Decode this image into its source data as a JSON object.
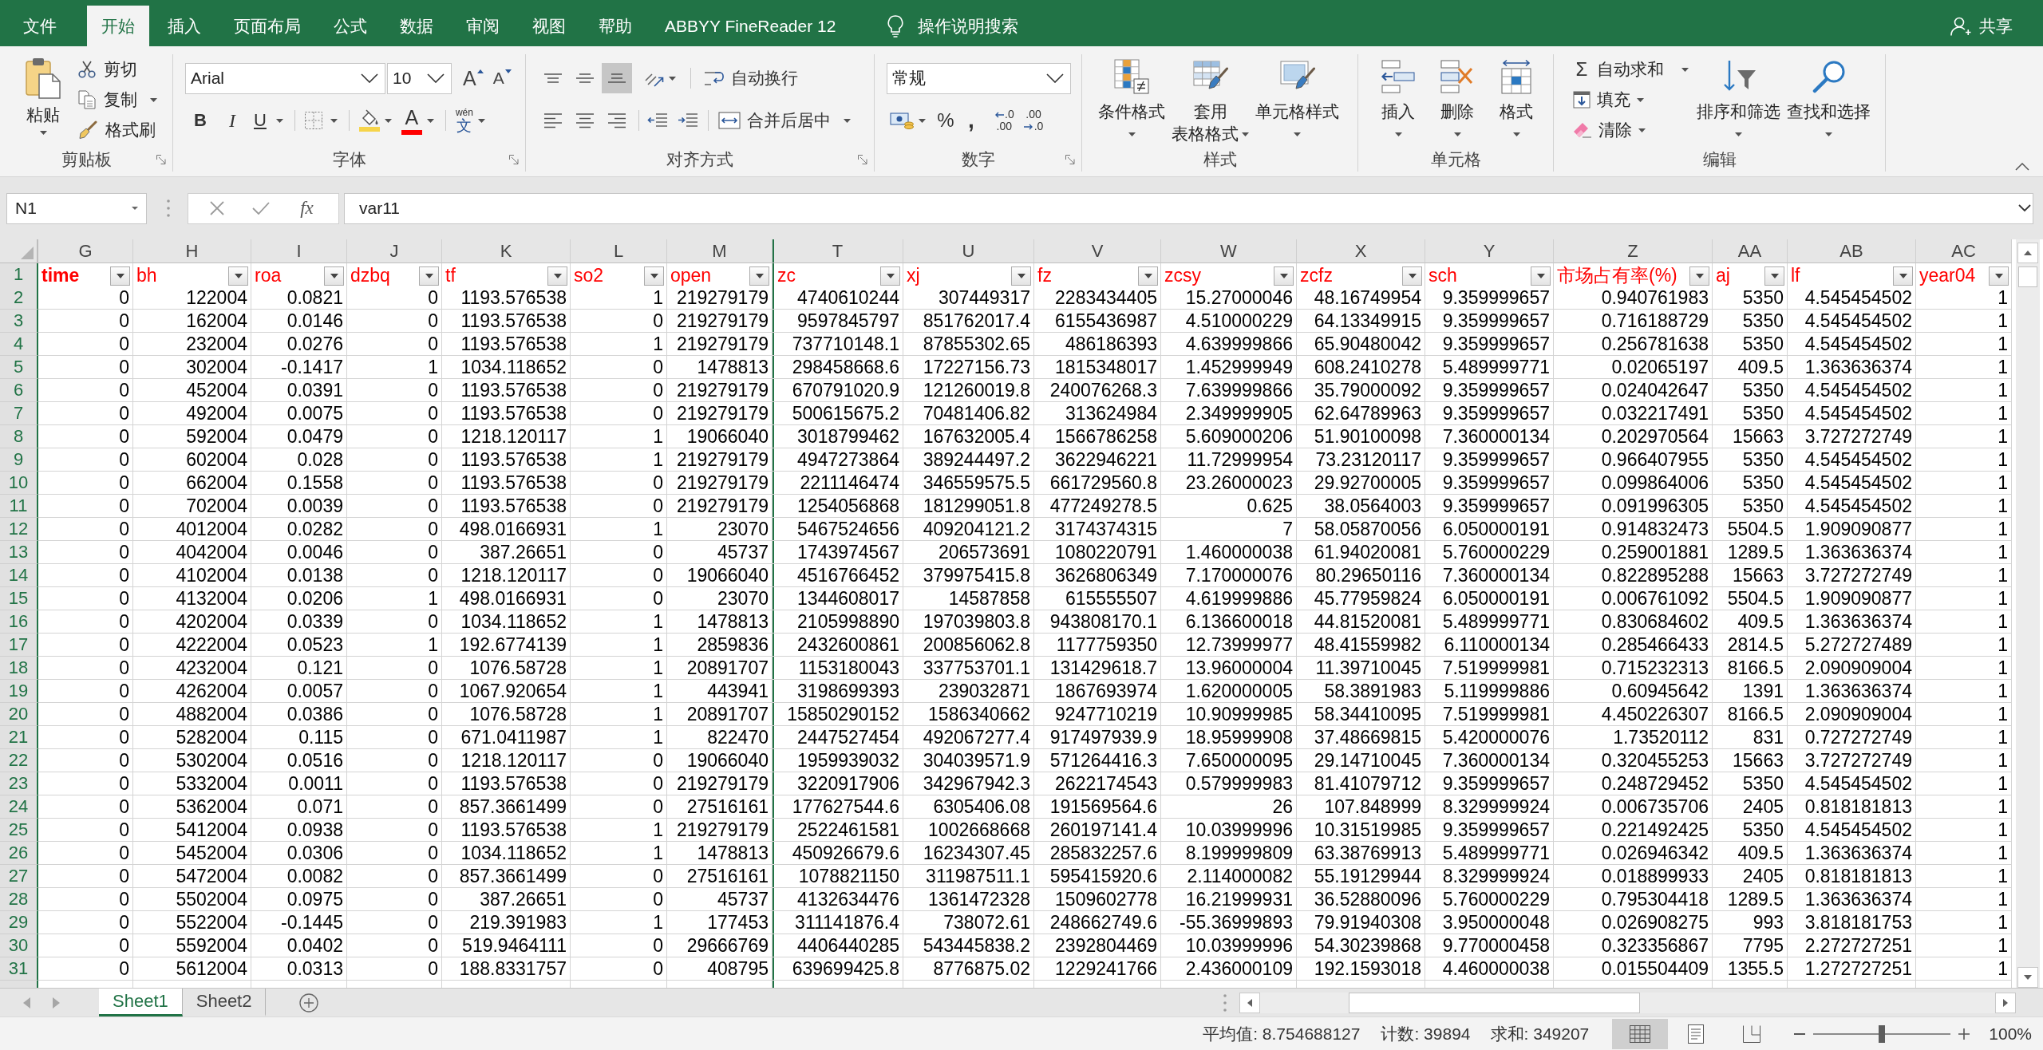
{
  "menu_tabs": [
    {
      "label": "文件",
      "selected": false
    },
    {
      "label": "开始",
      "selected": true
    },
    {
      "label": "插入",
      "selected": false
    },
    {
      "label": "页面布局",
      "selected": false
    },
    {
      "label": "公式",
      "selected": false
    },
    {
      "label": "数据",
      "selected": false
    },
    {
      "label": "审阅",
      "selected": false
    },
    {
      "label": "视图",
      "selected": false
    },
    {
      "label": "帮助",
      "selected": false
    },
    {
      "label": "ABBYY FineReader 12",
      "selected": false
    }
  ],
  "tell_me": "操作说明搜索",
  "share": "共享",
  "ribbon": {
    "clipboard": {
      "label": "剪贴板",
      "paste": "粘贴",
      "cut": "剪切",
      "copy": "复制",
      "format_painter": "格式刷"
    },
    "font": {
      "label": "字体",
      "font_name": "Arial",
      "font_size": "10",
      "grow": "A",
      "shrink": "A",
      "bold": "B",
      "italic": "I",
      "underline": "U",
      "font_color": "A",
      "phonetic": "wén",
      "phonetic_char": "文"
    },
    "alignment": {
      "label": "对齐方式",
      "vertical": [
        {
          "kind": "top",
          "selected": false
        },
        {
          "kind": "middle",
          "selected": false
        },
        {
          "kind": "bottom",
          "selected": true
        }
      ],
      "horizontal": [
        {
          "kind": "left",
          "selected": false
        },
        {
          "kind": "center",
          "selected": false
        },
        {
          "kind": "right",
          "selected": false
        }
      ],
      "wrap_text": "自动换行",
      "merge_center": "合并后居中"
    },
    "number": {
      "label": "数字",
      "format": "常规",
      "percent": "%",
      "comma": ",",
      "increase_decimal": [
        ".0",
        ".00"
      ],
      "decrease_decimal": [
        ".00",
        ".0"
      ]
    },
    "styles": {
      "label": "样式",
      "buttons": [
        {
          "kind": "conditional_formatting",
          "label": "条件格式"
        },
        {
          "kind": "format_as_table",
          "label": "套用",
          "label_2": "表格格式"
        },
        {
          "kind": "cell_styles",
          "label": "单元格样式"
        }
      ]
    },
    "cells": {
      "label": "单元格",
      "buttons": [
        {
          "kind": "insert",
          "label": "插入"
        },
        {
          "kind": "delete",
          "label": "删除"
        },
        {
          "kind": "format",
          "label": "格式"
        }
      ]
    },
    "editing": {
      "label": "编辑",
      "autosum_symbol": "Σ",
      "autosum": "自动求和",
      "fill": "填充",
      "clear": "清除",
      "buttons": [
        {
          "kind": "sort_filter",
          "label": "排序和筛选"
        },
        {
          "kind": "find_select",
          "label": "查找和选择"
        }
      ]
    }
  },
  "formula_bar": {
    "name_box": "N1",
    "function_symbol": "fx",
    "formula": "var11"
  },
  "sheet": {
    "columns": [
      {
        "letter": "G",
        "name": "time",
        "bold": true,
        "selected_edge": false
      },
      {
        "letter": "H",
        "name": "bh",
        "bold": false,
        "selected_edge": false
      },
      {
        "letter": "I",
        "name": "roa",
        "bold": false,
        "selected_edge": false
      },
      {
        "letter": "J",
        "name": "dzbq",
        "bold": false,
        "selected_edge": false
      },
      {
        "letter": "K",
        "name": "tf",
        "bold": false,
        "selected_edge": false
      },
      {
        "letter": "L",
        "name": "so2",
        "bold": false,
        "selected_edge": false
      },
      {
        "letter": "M",
        "name": "open",
        "bold": false,
        "selected_edge": false
      },
      {
        "letter": "T",
        "name": "zc",
        "bold": false,
        "selected_edge": true
      },
      {
        "letter": "U",
        "name": "xj",
        "bold": false,
        "selected_edge": false
      },
      {
        "letter": "V",
        "name": "fz",
        "bold": false,
        "selected_edge": false
      },
      {
        "letter": "W",
        "name": "zcsy",
        "bold": false,
        "selected_edge": false
      },
      {
        "letter": "X",
        "name": "zcfz",
        "bold": false,
        "selected_edge": false
      },
      {
        "letter": "Y",
        "name": "sch",
        "bold": false,
        "selected_edge": false
      },
      {
        "letter": "Z",
        "name": "市场占有率(%)",
        "bold": false,
        "selected_edge": false
      },
      {
        "letter": "AA",
        "name": "aj",
        "bold": false,
        "selected_edge": false
      },
      {
        "letter": "AB",
        "name": "lf",
        "bold": false,
        "selected_edge": false
      },
      {
        "letter": "AC",
        "name": "year04",
        "bold": false,
        "selected_edge": false
      }
    ],
    "header_row_number": "1",
    "rows": [
      {
        "number": "2",
        "cells": [
          "0",
          "122004",
          "0.0821",
          "0",
          "1193.576538",
          "1",
          "219279179",
          "4740610244",
          "307449317",
          "2283434405",
          "15.27000046",
          "48.16749954",
          "9.359999657",
          "0.940761983",
          "5350",
          "4.545454502",
          "1"
        ]
      },
      {
        "number": "3",
        "cells": [
          "0",
          "162004",
          "0.0146",
          "0",
          "1193.576538",
          "0",
          "219279179",
          "9597845797",
          "851762017.4",
          "6155436987",
          "4.510000229",
          "64.13349915",
          "9.359999657",
          "0.716188729",
          "5350",
          "4.545454502",
          "1"
        ]
      },
      {
        "number": "4",
        "cells": [
          "0",
          "232004",
          "0.0276",
          "0",
          "1193.576538",
          "1",
          "219279179",
          "737710148.1",
          "87855302.65",
          "486186393",
          "4.639999866",
          "65.90480042",
          "9.359999657",
          "0.256781638",
          "5350",
          "4.545454502",
          "1"
        ]
      },
      {
        "number": "5",
        "cells": [
          "0",
          "302004",
          "-0.1417",
          "1",
          "1034.118652",
          "0",
          "1478813",
          "298458668.6",
          "17227156.73",
          "1815348017",
          "1.452999949",
          "608.2410278",
          "5.489999771",
          "0.02065197",
          "409.5",
          "1.363636374",
          "1"
        ]
      },
      {
        "number": "6",
        "cells": [
          "0",
          "452004",
          "0.0391",
          "0",
          "1193.576538",
          "0",
          "219279179",
          "670791020.9",
          "121260019.8",
          "240076268.3",
          "7.639999866",
          "35.79000092",
          "9.359999657",
          "0.024042647",
          "5350",
          "4.545454502",
          "1"
        ]
      },
      {
        "number": "7",
        "cells": [
          "0",
          "492004",
          "0.0075",
          "0",
          "1193.576538",
          "0",
          "219279179",
          "500615675.2",
          "70481406.82",
          "313624984",
          "2.349999905",
          "62.64789963",
          "9.359999657",
          "0.032217491",
          "5350",
          "4.545454502",
          "1"
        ]
      },
      {
        "number": "8",
        "cells": [
          "0",
          "592004",
          "0.0479",
          "0",
          "1218.120117",
          "1",
          "19066040",
          "3018799462",
          "167632005.4",
          "1566786258",
          "5.609000206",
          "51.90100098",
          "7.360000134",
          "0.202970564",
          "15663",
          "3.727272749",
          "1"
        ]
      },
      {
        "number": "9",
        "cells": [
          "0",
          "602004",
          "0.028",
          "0",
          "1193.576538",
          "1",
          "219279179",
          "4947273864",
          "389244497.2",
          "3622946221",
          "11.72999954",
          "73.23120117",
          "9.359999657",
          "0.966407955",
          "5350",
          "4.545454502",
          "1"
        ]
      },
      {
        "number": "10",
        "cells": [
          "0",
          "662004",
          "0.1558",
          "0",
          "1193.576538",
          "0",
          "219279179",
          "2211146474",
          "346559575.5",
          "661729560.8",
          "23.26000023",
          "29.92700005",
          "9.359999657",
          "0.099864006",
          "5350",
          "4.545454502",
          "1"
        ]
      },
      {
        "number": "11",
        "cells": [
          "0",
          "702004",
          "0.0039",
          "0",
          "1193.576538",
          "0",
          "219279179",
          "1254056868",
          "181299051.8",
          "477249278.5",
          "0.625",
          "38.0564003",
          "9.359999657",
          "0.091996305",
          "5350",
          "4.545454502",
          "1"
        ]
      },
      {
        "number": "12",
        "cells": [
          "0",
          "4012004",
          "0.0282",
          "0",
          "498.0166931",
          "1",
          "23070",
          "5467524656",
          "409204121.2",
          "3174374315",
          "7",
          "58.05870056",
          "6.050000191",
          "0.914832473",
          "5504.5",
          "1.909090877",
          "1"
        ]
      },
      {
        "number": "13",
        "cells": [
          "0",
          "4042004",
          "0.0046",
          "0",
          "387.26651",
          "0",
          "45737",
          "1743974567",
          "206573691",
          "1080220791",
          "1.460000038",
          "61.94020081",
          "5.760000229",
          "0.259001881",
          "1289.5",
          "1.363636374",
          "1"
        ]
      },
      {
        "number": "14",
        "cells": [
          "0",
          "4102004",
          "0.0138",
          "0",
          "1218.120117",
          "0",
          "19066040",
          "4516766452",
          "379975415.8",
          "3626806349",
          "7.170000076",
          "80.29650116",
          "7.360000134",
          "0.822895288",
          "15663",
          "3.727272749",
          "1"
        ]
      },
      {
        "number": "15",
        "cells": [
          "0",
          "4132004",
          "0.0206",
          "1",
          "498.0166931",
          "0",
          "23070",
          "1344608017",
          "14587858",
          "615555507",
          "4.619999886",
          "45.77959824",
          "6.050000191",
          "0.006761092",
          "5504.5",
          "1.909090877",
          "1"
        ]
      },
      {
        "number": "16",
        "cells": [
          "0",
          "4202004",
          "0.0339",
          "0",
          "1034.118652",
          "1",
          "1478813",
          "2105998890",
          "197039803.8",
          "943808170.1",
          "6.136600018",
          "44.81520081",
          "5.489999771",
          "0.830684602",
          "409.5",
          "1.363636374",
          "1"
        ]
      },
      {
        "number": "17",
        "cells": [
          "0",
          "4222004",
          "0.0523",
          "1",
          "192.6774139",
          "1",
          "2859836",
          "2432600861",
          "200856062.8",
          "1177759350",
          "12.73999977",
          "48.41559982",
          "6.110000134",
          "0.285466433",
          "2814.5",
          "5.272727489",
          "1"
        ]
      },
      {
        "number": "18",
        "cells": [
          "0",
          "4232004",
          "0.121",
          "0",
          "1076.58728",
          "1",
          "20891707",
          "1153180043",
          "337753701.1",
          "131429618.7",
          "13.96000004",
          "11.39710045",
          "7.519999981",
          "0.715232313",
          "8166.5",
          "2.090909004",
          "1"
        ]
      },
      {
        "number": "19",
        "cells": [
          "0",
          "4262004",
          "0.0057",
          "0",
          "1067.920654",
          "1",
          "443941",
          "3198699393",
          "239032871",
          "1867693974",
          "1.620000005",
          "58.3891983",
          "5.119999886",
          "0.60945642",
          "1391",
          "1.363636374",
          "1"
        ]
      },
      {
        "number": "20",
        "cells": [
          "0",
          "4882004",
          "0.0386",
          "0",
          "1076.58728",
          "1",
          "20891707",
          "15850290152",
          "1586340662",
          "9247710219",
          "10.90999985",
          "58.34410095",
          "7.519999981",
          "4.450226307",
          "8166.5",
          "2.090909004",
          "1"
        ]
      },
      {
        "number": "21",
        "cells": [
          "0",
          "5282004",
          "0.115",
          "0",
          "671.0411987",
          "1",
          "822470",
          "2447527454",
          "492067277.4",
          "917497939.9",
          "18.95999908",
          "37.48669815",
          "5.420000076",
          "1.73520112",
          "831",
          "0.727272749",
          "1"
        ]
      },
      {
        "number": "22",
        "cells": [
          "0",
          "5302004",
          "0.0516",
          "0",
          "1218.120117",
          "0",
          "19066040",
          "1959939032",
          "304039571.9",
          "571264416.3",
          "7.650000095",
          "29.14710045",
          "7.360000134",
          "0.320455253",
          "15663",
          "3.727272749",
          "1"
        ]
      },
      {
        "number": "23",
        "cells": [
          "0",
          "5332004",
          "0.0011",
          "0",
          "1193.576538",
          "0",
          "219279179",
          "3220917906",
          "342967942.3",
          "2622174543",
          "0.579999983",
          "81.41079712",
          "9.359999657",
          "0.248729452",
          "5350",
          "4.545454502",
          "1"
        ]
      },
      {
        "number": "24",
        "cells": [
          "0",
          "5362004",
          "0.071",
          "0",
          "857.3661499",
          "0",
          "27516161",
          "177627544.6",
          "6305406.08",
          "191569564.6",
          "26",
          "107.848999",
          "8.329999924",
          "0.006735706",
          "2405",
          "0.818181813",
          "1"
        ]
      },
      {
        "number": "25",
        "cells": [
          "0",
          "5412004",
          "0.0938",
          "0",
          "1193.576538",
          "1",
          "219279179",
          "2522461581",
          "1002668668",
          "260197141.4",
          "10.03999996",
          "10.31519985",
          "9.359999657",
          "0.221492425",
          "5350",
          "4.545454502",
          "1"
        ]
      },
      {
        "number": "26",
        "cells": [
          "0",
          "5452004",
          "0.0306",
          "0",
          "1034.118652",
          "1",
          "1478813",
          "450926679.6",
          "16234307.45",
          "285832257.6",
          "8.199999809",
          "63.38769913",
          "5.489999771",
          "0.026946342",
          "409.5",
          "1.363636374",
          "1"
        ]
      },
      {
        "number": "27",
        "cells": [
          "0",
          "5472004",
          "0.0082",
          "0",
          "857.3661499",
          "0",
          "27516161",
          "1078821150",
          "311987511.1",
          "595415920.6",
          "2.114000082",
          "55.19129944",
          "8.329999924",
          "0.018899933",
          "2405",
          "0.818181813",
          "1"
        ]
      },
      {
        "number": "28",
        "cells": [
          "0",
          "5502004",
          "0.0975",
          "0",
          "387.26651",
          "0",
          "45737",
          "4132634476",
          "1361472328",
          "1509602778",
          "16.21999931",
          "36.52880096",
          "5.760000229",
          "0.795304418",
          "1289.5",
          "1.363636374",
          "1"
        ]
      },
      {
        "number": "29",
        "cells": [
          "0",
          "5522004",
          "-0.1445",
          "0",
          "219.391983",
          "1",
          "177453",
          "311141876.4",
          "738072.61",
          "248662749.6",
          "-55.36999893",
          "79.91940308",
          "3.950000048",
          "0.026908275",
          "993",
          "3.818181753",
          "1"
        ]
      },
      {
        "number": "30",
        "cells": [
          "0",
          "5592004",
          "0.0402",
          "0",
          "519.9464111",
          "0",
          "29666769",
          "4406440285",
          "543445838.2",
          "2392804469",
          "10.03999996",
          "54.30239868",
          "9.770000458",
          "0.323356867",
          "7795",
          "2.272727251",
          "1"
        ]
      },
      {
        "number": "31",
        "cells": [
          "0",
          "5612004",
          "0.0313",
          "0",
          "188.8331757",
          "0",
          "408795",
          "639699425.8",
          "8776875.02",
          "1229241766",
          "2.436000109",
          "192.1593018",
          "4.460000038",
          "0.015504409",
          "1355.5",
          "1.272727251",
          "1"
        ]
      }
    ]
  },
  "sheet_tabs": [
    {
      "label": "Sheet1",
      "selected": true
    },
    {
      "label": "Sheet2",
      "selected": false
    }
  ],
  "status_bar": {
    "average": "平均值: 8.754688127",
    "count": "计数: 39894",
    "sum": "求和: 349207",
    "views": [
      {
        "kind": "normal",
        "selected": true
      },
      {
        "kind": "page_layout",
        "selected": false
      },
      {
        "kind": "page_break",
        "selected": false
      }
    ],
    "zoom": {
      "level": 0.5,
      "label": "100%"
    }
  }
}
